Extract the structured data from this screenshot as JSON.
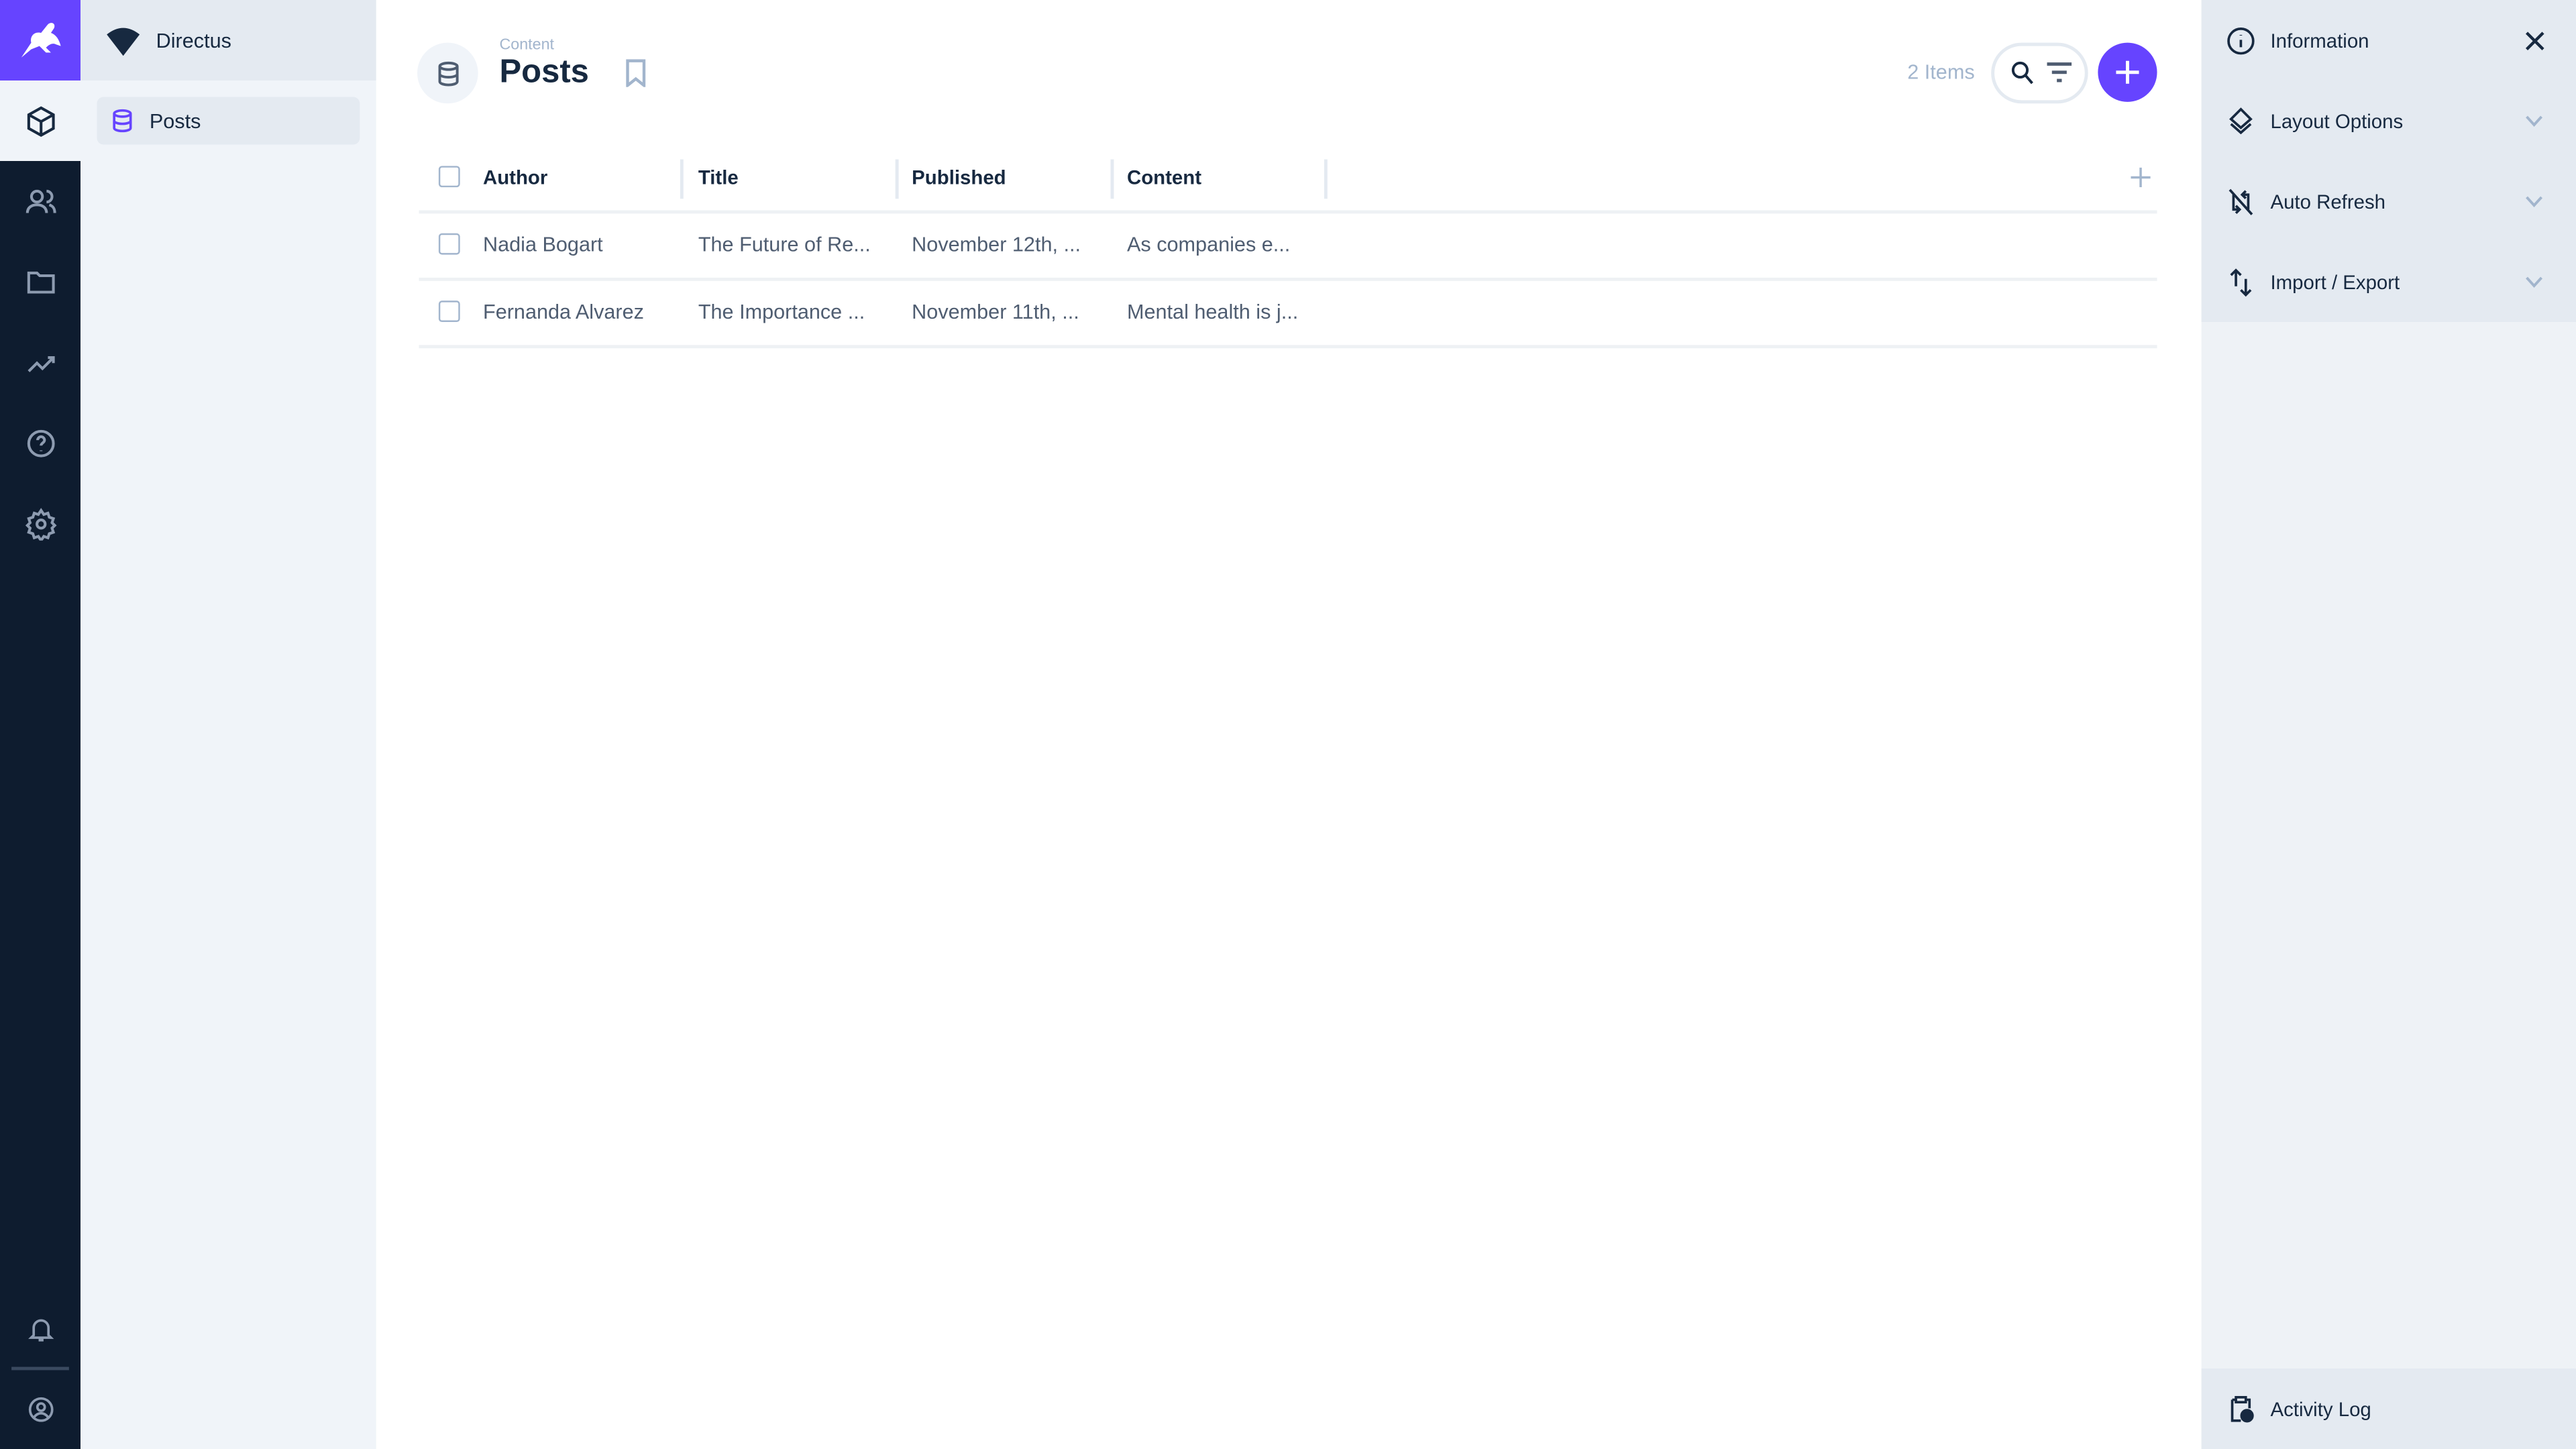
{
  "app": {
    "project_name": "Directus",
    "accent": "#6644ff"
  },
  "module_bar": {
    "items": [
      "content-icon",
      "users-icon",
      "files-icon",
      "insights-icon",
      "help-icon",
      "settings-icon"
    ],
    "bottom": [
      "notifications-icon",
      "user-icon"
    ]
  },
  "navigation": {
    "items": [
      {
        "label": "Posts",
        "icon": "database-icon"
      }
    ]
  },
  "header": {
    "breadcrumb": "Content",
    "title": "Posts",
    "item_count": "2 Items"
  },
  "table": {
    "columns": [
      "Author",
      "Title",
      "Published",
      "Content"
    ],
    "rows": [
      [
        "Nadia Bogart",
        "The Future of Re...",
        "November 12th, ...",
        "As companies e..."
      ],
      [
        "Fernanda Alvarez",
        "The Importance ...",
        "November 11th, ...",
        "Mental health is j..."
      ]
    ]
  },
  "sidebar": {
    "sections": [
      "Information",
      "Layout Options",
      "Auto Refresh",
      "Import / Export"
    ],
    "activity_log": "Activity Log"
  }
}
